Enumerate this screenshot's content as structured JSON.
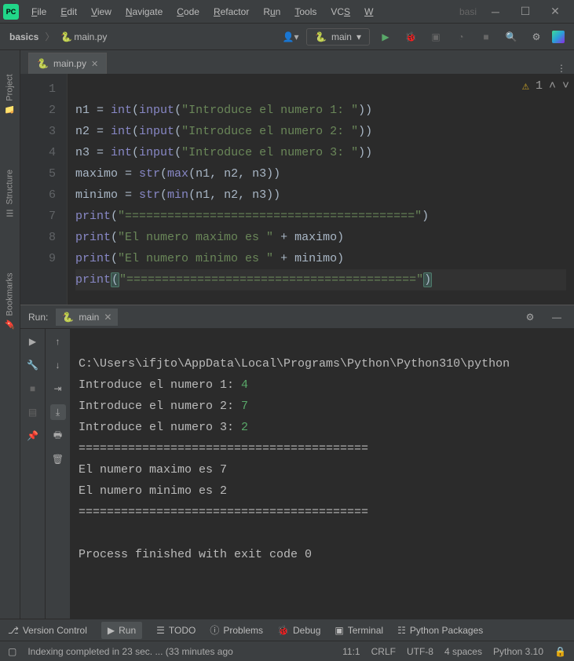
{
  "menubar": {
    "items": [
      {
        "ul": "F",
        "rest": "ile"
      },
      {
        "ul": "E",
        "rest": "dit"
      },
      {
        "ul": "V",
        "rest": "iew"
      },
      {
        "ul": "N",
        "rest": "avigate"
      },
      {
        "ul": "C",
        "rest": "ode"
      },
      {
        "ul": "R",
        "rest": "efactor"
      },
      {
        "ul": "",
        "rest": "R"
      },
      {
        "ul": "T",
        "rest": "ools"
      },
      {
        "ul": "",
        "rest": "VC"
      },
      {
        "ul": "W",
        "rest": ""
      }
    ],
    "file": "File",
    "edit": "Edit",
    "view": "View",
    "navigate": "Navigate",
    "code": "Code",
    "refactor": "Refactor",
    "run": "Run",
    "tools": "Tools",
    "vcs": "VCS",
    "window": "W",
    "search_hint": "basi"
  },
  "breadcrumbs": {
    "project": "basics",
    "file": "main.py"
  },
  "runconfig": {
    "label": "main"
  },
  "editor": {
    "tab": "main.py",
    "lines": [
      "1",
      "2",
      "3",
      "4",
      "5",
      "6",
      "7",
      "8",
      "9"
    ],
    "warning_count": "1",
    "code": {
      "l1_var": "n1 = ",
      "l1_fn1": "int",
      "l1_p1": "(",
      "l1_fn2": "input",
      "l1_p2": "(",
      "l1_str": "\"Introduce el numero 1: \"",
      "l1_p3": "))",
      "l2_var": "n2 = ",
      "l2_fn1": "int",
      "l2_p1": "(",
      "l2_fn2": "input",
      "l2_p2": "(",
      "l2_str": "\"Introduce el numero 2: \"",
      "l2_p3": "))",
      "l3_var": "n3 = ",
      "l3_fn1": "int",
      "l3_p1": "(",
      "l3_fn2": "input",
      "l3_p2": "(",
      "l3_str": "\"Introduce el numero 3: \"",
      "l3_p3": "))",
      "l4_var": "maximo = ",
      "l4_fn1": "str",
      "l4_p1": "(",
      "l4_fn2": "max",
      "l4_p2": "(n1, n2, n3))",
      "l5_var": "minimo = ",
      "l5_fn1": "str",
      "l5_p1": "(",
      "l5_fn2": "min",
      "l5_p2": "(n1, n2, n3))",
      "l6_fn": "print",
      "l6_p1": "(",
      "l6_str": "\"=========================================\"",
      "l6_p2": ")",
      "l7_fn": "print",
      "l7_p1": "(",
      "l7_str": "\"El numero maximo es \"",
      "l7_rest": " + maximo)",
      "l8_fn": "print",
      "l8_p1": "(",
      "l8_str": "\"El numero minimo es \"",
      "l8_rest": " + minimo)",
      "l9_fn": "print",
      "l9_p1": "(",
      "l9_str": "\"=========================================\"",
      "l9_p2": ")"
    }
  },
  "run_panel": {
    "title": "Run:",
    "tab": "main",
    "output": {
      "cmd": "C:\\Users\\ifjto\\AppData\\Local\\Programs\\Python\\Python310\\python",
      "p1": "Introduce el numero 1: ",
      "i1": "4",
      "p2": "Introduce el numero 2: ",
      "i2": "7",
      "p3": "Introduce el numero 3: ",
      "i3": "2",
      "sep1": "=========================================",
      "max": "El numero maximo es 7",
      "min": "El numero minimo es 2",
      "sep2": "=========================================",
      "blank": "",
      "exit": "Process finished with exit code 0"
    }
  },
  "left_rail": {
    "project": "Project",
    "structure": "Structure",
    "bookmarks": "Bookmarks"
  },
  "bottombar": {
    "vcs": "Version Control",
    "run": "Run",
    "todo": "TODO",
    "problems": "Problems",
    "debug": "Debug",
    "terminal": "Terminal",
    "packages": "Python Packages"
  },
  "statusbar": {
    "message": "Indexing completed in 23 sec. ... (33 minutes ago",
    "pos": "11:1",
    "eol": "CRLF",
    "enc": "UTF-8",
    "indent": "4 spaces",
    "interpreter": "Python 3.10"
  }
}
